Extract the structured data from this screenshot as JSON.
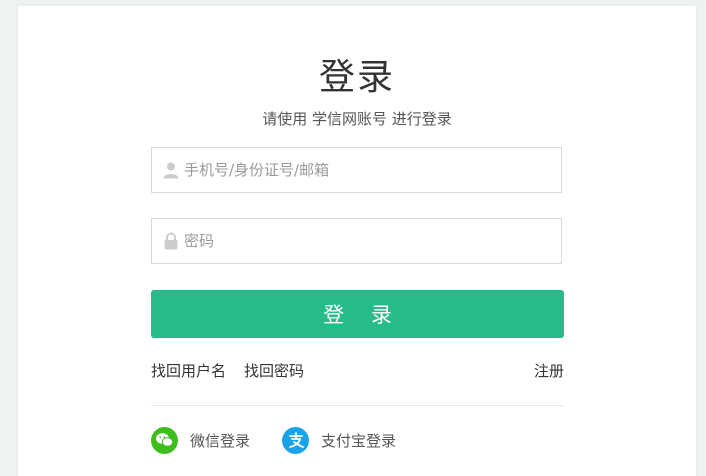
{
  "login": {
    "title": "登录",
    "subtitle": "请使用 学信网账号 进行登录",
    "username_placeholder": "手机号/身份证号/邮箱",
    "password_placeholder": "密码",
    "button_label": "登 录"
  },
  "links": {
    "find_username": "找回用户名",
    "find_password": "找回密码",
    "register": "注册"
  },
  "social": {
    "wechat_label": "微信登录",
    "alipay_label": "支付宝登录"
  },
  "colors": {
    "accent": "#26bb88",
    "wechat": "#3ebd1c",
    "alipay": "#1aa3e8"
  }
}
